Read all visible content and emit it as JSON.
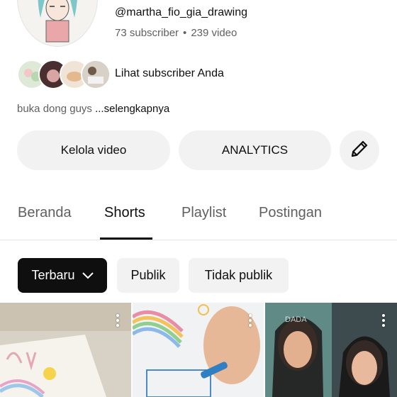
{
  "channel": {
    "handle": "@martha_fio_gia_drawing",
    "subscribers": "73 subscriber",
    "separator": "•",
    "videos": "239 video",
    "view_subscribers_label": "Lihat subscriber Anda",
    "description_prefix": "buka dong guys ",
    "more_label": "...selengkapnya"
  },
  "actions": {
    "manage_videos_label": "Kelola video",
    "analytics_label": "ANALYTICS",
    "edit_icon": "pencil-icon"
  },
  "tabs": [
    {
      "label": "Beranda",
      "active": false
    },
    {
      "label": "Shorts",
      "active": true
    },
    {
      "label": "Playlist",
      "active": false
    },
    {
      "label": "Postingan",
      "active": false
    }
  ],
  "filters": [
    {
      "label": "Terbaru",
      "active": true,
      "icon": "chevron-down-icon"
    },
    {
      "label": "Publik",
      "active": false
    },
    {
      "label": "Tidak publik",
      "active": false
    }
  ],
  "shorts": [
    {
      "overlay_text": ""
    },
    {
      "overlay_text": ""
    },
    {
      "overlay_text": "DADA"
    }
  ],
  "colors": {
    "text_primary": "#0f0f0f",
    "text_secondary": "#606060",
    "chip_bg": "#f2f2f2",
    "chip_active_bg": "#0f0f0f"
  }
}
